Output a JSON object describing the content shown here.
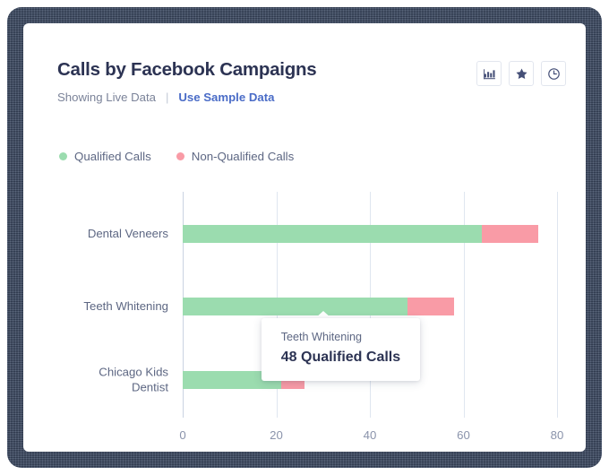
{
  "card": {
    "title": "Calls by Facebook Campaigns",
    "status_text": "Showing Live Data",
    "separator": "|",
    "sample_link": "Use Sample Data"
  },
  "toolbar": {
    "buttons": [
      {
        "name": "bar-chart-icon",
        "label": "Bar Chart"
      },
      {
        "name": "star-icon",
        "label": "Favorite"
      },
      {
        "name": "clock-icon",
        "label": "History"
      }
    ]
  },
  "colors": {
    "qualified": "#9bdcaf",
    "non_qualified": "#f99ba6",
    "title": "#2c3353",
    "muted": "#7b8399",
    "link": "#4a6cc7",
    "gridline": "#dfe6f0",
    "frame": "#3c4a63"
  },
  "tooltip": {
    "title": "Teeth Whitening",
    "value": "48 Qualified Calls"
  },
  "chart_data": {
    "type": "bar",
    "orientation": "horizontal",
    "stacked": true,
    "title": "Calls by Facebook Campaigns",
    "xlabel": "",
    "ylabel": "",
    "xlim": [
      0,
      80
    ],
    "xticks": [
      0,
      20,
      40,
      60,
      80
    ],
    "grid": true,
    "legend_position": "top-left",
    "categories": [
      "Dental Veneers",
      "Teeth Whitening",
      "Chicago Kids Dentist"
    ],
    "series": [
      {
        "name": "Qualified Calls",
        "color": "#9bdcaf",
        "values": [
          64,
          48,
          21
        ]
      },
      {
        "name": "Non-Qualified Calls",
        "color": "#f99ba6",
        "values": [
          12,
          10,
          5
        ]
      }
    ]
  }
}
